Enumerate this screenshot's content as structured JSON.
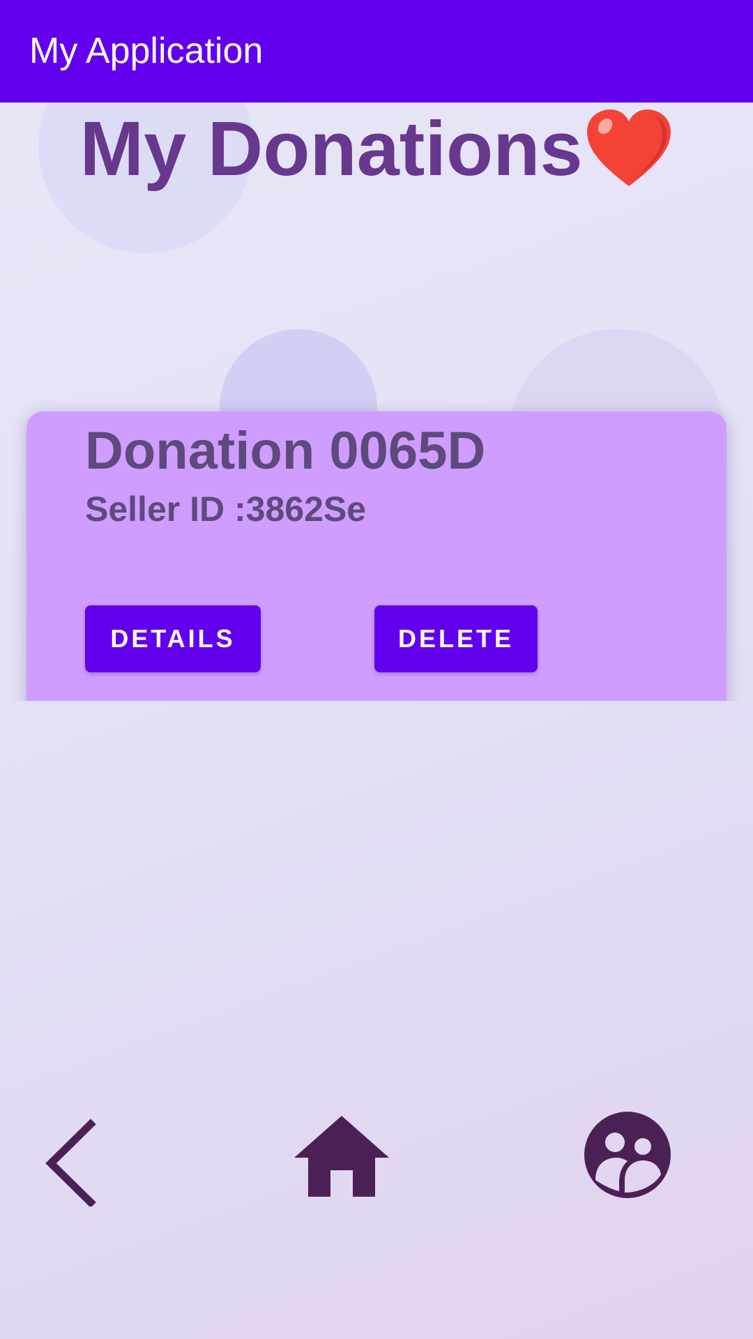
{
  "app_bar": {
    "title": "My Application",
    "color": "#6200ee"
  },
  "page": {
    "title": "My Donations",
    "title_emoji": "heart-icon"
  },
  "donation_card": {
    "title": "Donation 0065D",
    "seller_id": "Seller ID :3862Se",
    "details_label": "DETAILS",
    "delete_label": "DELETE",
    "card_color": "#cf9dff",
    "button_color": "#6200ee"
  },
  "bottom_nav": {
    "icons": [
      "back-icon",
      "home-icon",
      "people-icon"
    ],
    "icon_color": "#4b2155"
  }
}
